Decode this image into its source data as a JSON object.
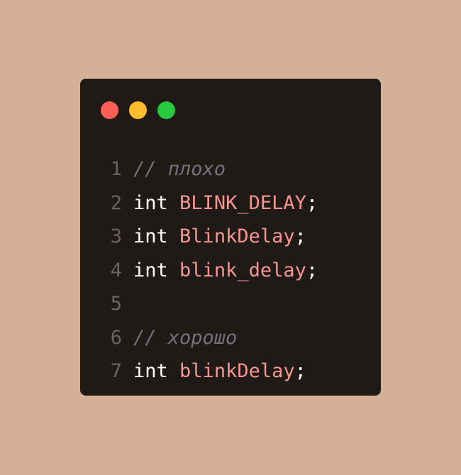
{
  "window": {
    "controls": [
      {
        "name": "close",
        "color": "#ff5f56"
      },
      {
        "name": "minimize",
        "color": "#ffbd2e"
      },
      {
        "name": "maximize",
        "color": "#27c93f"
      }
    ]
  },
  "code": {
    "lines": [
      {
        "num": "1",
        "comment": "// плохо"
      },
      {
        "num": "2",
        "keyword": "int",
        "identifier": "BLINK_DELAY",
        "punct": ";"
      },
      {
        "num": "3",
        "keyword": "int",
        "identifier": "BlinkDelay",
        "punct": ";"
      },
      {
        "num": "4",
        "keyword": "int",
        "identifier": "blink_delay",
        "punct": ";"
      },
      {
        "num": "5"
      },
      {
        "num": "6",
        "comment": "// хорошо"
      },
      {
        "num": "7",
        "keyword": "int",
        "identifier": "blinkDelay",
        "punct": ";"
      }
    ]
  },
  "colors": {
    "background": "#d3b096",
    "editor": "#201a17",
    "keyword": "#ffffff",
    "identifier": "#f59593",
    "comment": "#75707b",
    "line_number": "#6a6461"
  }
}
